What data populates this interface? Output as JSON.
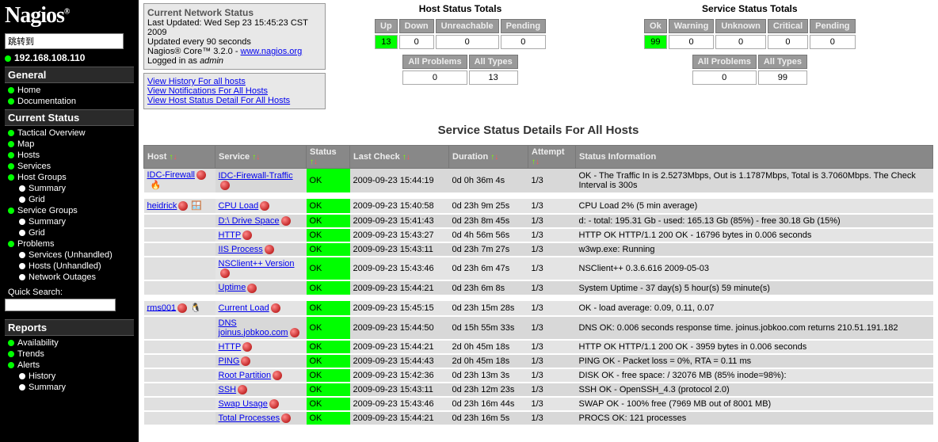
{
  "logo": "Nagios",
  "logo_reg": "®",
  "jump_label": "跳转到",
  "ip": "192.168.108.110",
  "nav": {
    "general": "General",
    "home": "Home",
    "documentation": "Documentation",
    "current_status": "Current Status",
    "tactical": "Tactical Overview",
    "map": "Map",
    "hosts": "Hosts",
    "services": "Services",
    "host_groups": "Host Groups",
    "summary": "Summary",
    "grid": "Grid",
    "service_groups": "Service Groups",
    "problems": "Problems",
    "services_unhandled": "Services (Unhandled)",
    "hosts_unhandled": "Hosts (Unhandled)",
    "network_outages": "Network Outages",
    "quick_search": "Quick Search:",
    "reports": "Reports",
    "availability": "Availability",
    "trends": "Trends",
    "alerts": "Alerts",
    "history": "History",
    "summary2": "Summary"
  },
  "info": {
    "title": "Current Network Status",
    "updated": "Last Updated: Wed Sep 23 15:45:23 CST 2009",
    "every": "Updated every 90 seconds",
    "core": "Nagios® Core™ 3.2.0 - ",
    "core_link": "www.nagios.org",
    "logged": "Logged in as ",
    "user": "admin",
    "links": {
      "history": "View History For all hosts",
      "notifications": "View Notifications For All Hosts",
      "detail": "View Host Status Detail For All Hosts"
    }
  },
  "host_totals": {
    "title": "Host Status Totals",
    "h": {
      "up": "Up",
      "down": "Down",
      "unreach": "Unreachable",
      "pending": "Pending",
      "all_prob": "All Problems",
      "all_types": "All Types"
    },
    "v": {
      "up": "13",
      "down": "0",
      "unreach": "0",
      "pending": "0",
      "all_prob": "0",
      "all_types": "13"
    }
  },
  "svc_totals": {
    "title": "Service Status Totals",
    "h": {
      "ok": "Ok",
      "warn": "Warning",
      "unk": "Unknown",
      "crit": "Critical",
      "pending": "Pending",
      "all_prob": "All Problems",
      "all_types": "All Types"
    },
    "v": {
      "ok": "99",
      "warn": "0",
      "unk": "0",
      "crit": "0",
      "pending": "0",
      "all_prob": "0",
      "all_types": "99"
    }
  },
  "section_title": "Service Status Details For All Hosts",
  "cols": {
    "host": "Host",
    "service": "Service",
    "status": "Status",
    "last": "Last Check",
    "duration": "Duration",
    "attempt": "Attempt",
    "info": "Status Information"
  },
  "rows": [
    {
      "host": "IDC-Firewall",
      "svc": "IDC-Firewall-Traffic",
      "status": "OK",
      "last": "2009-09-23 15:44:19",
      "dur": "0d 0h 36m 4s",
      "att": "1/3",
      "info": "OK - The Traffic In is 2.5273Mbps, Out is 1.1787Mbps, Total is 3.7060Mbps. The Check Interval is 300s"
    },
    {
      "host": "heidrick",
      "svc": "CPU Load",
      "status": "OK",
      "last": "2009-09-23 15:40:58",
      "dur": "0d 23h 9m 25s",
      "att": "1/3",
      "info": "CPU Load 2% (5 min average)"
    },
    {
      "host": "",
      "svc": "D:\\ Drive Space",
      "status": "OK",
      "last": "2009-09-23 15:41:43",
      "dur": "0d 23h 8m 45s",
      "att": "1/3",
      "info": "d: - total: 195.31 Gb - used: 165.13 Gb (85%) - free 30.18 Gb (15%)"
    },
    {
      "host": "",
      "svc": "HTTP",
      "status": "OK",
      "last": "2009-09-23 15:43:27",
      "dur": "0d 4h 56m 56s",
      "att": "1/3",
      "info": "HTTP OK HTTP/1.1 200 OK - 16796 bytes in 0.006 seconds"
    },
    {
      "host": "",
      "svc": "IIS Process",
      "status": "OK",
      "last": "2009-09-23 15:43:11",
      "dur": "0d 23h 7m 27s",
      "att": "1/3",
      "info": "w3wp.exe: Running"
    },
    {
      "host": "",
      "svc": "NSClient++ Version",
      "status": "OK",
      "last": "2009-09-23 15:43:46",
      "dur": "0d 23h 6m 47s",
      "att": "1/3",
      "info": "NSClient++ 0.3.6.616 2009-05-03"
    },
    {
      "host": "",
      "svc": "Uptime",
      "status": "OK",
      "last": "2009-09-23 15:44:21",
      "dur": "0d 23h 6m 8s",
      "att": "1/3",
      "info": "System Uptime - 37 day(s) 5 hour(s) 59 minute(s)"
    },
    {
      "host": "rms001",
      "svc": "Current Load",
      "status": "OK",
      "last": "2009-09-23 15:45:15",
      "dur": "0d 23h 15m 28s",
      "att": "1/3",
      "info": "OK - load average: 0.09, 0.11, 0.07"
    },
    {
      "host": "",
      "svc": "DNS joinus.jobkoo.com",
      "status": "OK",
      "last": "2009-09-23 15:44:50",
      "dur": "0d 15h 55m 33s",
      "att": "1/3",
      "info": "DNS OK: 0.006 seconds response time. joinus.jobkoo.com returns 210.51.191.182"
    },
    {
      "host": "",
      "svc": "HTTP",
      "status": "OK",
      "last": "2009-09-23 15:44:21",
      "dur": "2d 0h 45m 18s",
      "att": "1/3",
      "info": "HTTP OK HTTP/1.1 200 OK - 3959 bytes in 0.006 seconds"
    },
    {
      "host": "",
      "svc": "PING",
      "status": "OK",
      "last": "2009-09-23 15:44:43",
      "dur": "2d 0h 45m 18s",
      "att": "1/3",
      "info": "PING OK - Packet loss = 0%, RTA = 0.11 ms"
    },
    {
      "host": "",
      "svc": "Root Partition",
      "status": "OK",
      "last": "2009-09-23 15:42:36",
      "dur": "0d 23h 13m 3s",
      "att": "1/3",
      "info": "DISK OK - free space: / 32076 MB (85% inode=98%):"
    },
    {
      "host": "",
      "svc": "SSH",
      "status": "OK",
      "last": "2009-09-23 15:43:11",
      "dur": "0d 23h 12m 23s",
      "att": "1/3",
      "info": "SSH OK - OpenSSH_4.3 (protocol 2.0)"
    },
    {
      "host": "",
      "svc": "Swap Usage",
      "status": "OK",
      "last": "2009-09-23 15:43:46",
      "dur": "0d 23h 16m 44s",
      "att": "1/3",
      "info": "SWAP OK - 100% free (7969 MB out of 8001 MB)"
    },
    {
      "host": "",
      "svc": "Total Processes",
      "status": "OK",
      "last": "2009-09-23 15:44:21",
      "dur": "0d 23h 16m 5s",
      "att": "1/3",
      "info": "PROCS OK: 121 processes"
    }
  ]
}
